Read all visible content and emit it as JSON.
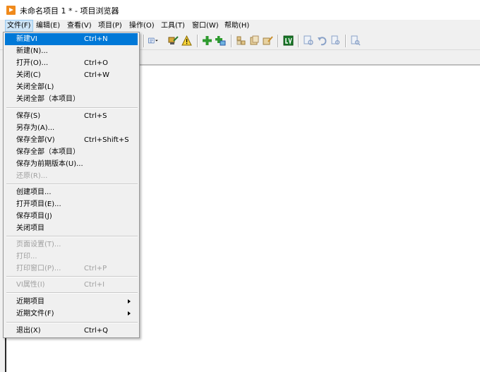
{
  "window": {
    "title": "未命名项目 1 * - 项目浏览器"
  },
  "menubar": [
    {
      "label": "文件(F)"
    },
    {
      "label": "编辑(E)"
    },
    {
      "label": "查看(V)"
    },
    {
      "label": "项目(P)"
    },
    {
      "label": "操作(O)"
    },
    {
      "label": "工具(T)"
    },
    {
      "label": "窗口(W)"
    },
    {
      "label": "帮助(H)"
    }
  ],
  "file_menu": {
    "groups": [
      [
        {
          "label": "新建VI",
          "shortcut": "Ctrl+N",
          "selected": true
        },
        {
          "label": "新建(N)...",
          "shortcut": ""
        },
        {
          "label": "打开(O)...",
          "shortcut": "Ctrl+O"
        },
        {
          "label": "关闭(C)",
          "shortcut": "Ctrl+W"
        },
        {
          "label": "关闭全部(L)",
          "shortcut": ""
        },
        {
          "label": "关闭全部（本项目）",
          "shortcut": ""
        }
      ],
      [
        {
          "label": "保存(S)",
          "shortcut": "Ctrl+S"
        },
        {
          "label": "另存为(A)...",
          "shortcut": ""
        },
        {
          "label": "保存全部(V)",
          "shortcut": "Ctrl+Shift+S"
        },
        {
          "label": "保存全部（本项目）",
          "shortcut": ""
        },
        {
          "label": "保存为前期版本(U)...",
          "shortcut": ""
        },
        {
          "label": "还原(R)...",
          "shortcut": "",
          "disabled": true
        }
      ],
      [
        {
          "label": "创建项目...",
          "shortcut": ""
        },
        {
          "label": "打开项目(E)...",
          "shortcut": ""
        },
        {
          "label": "保存项目(J)",
          "shortcut": ""
        },
        {
          "label": "关闭项目",
          "shortcut": ""
        }
      ],
      [
        {
          "label": "页面设置(T)...",
          "shortcut": "",
          "disabled": true
        },
        {
          "label": "打印...",
          "shortcut": "",
          "disabled": true
        },
        {
          "label": "打印窗口(P)...",
          "shortcut": "Ctrl+P",
          "disabled": true
        }
      ],
      [
        {
          "label": "VI属性(I)",
          "shortcut": "Ctrl+I",
          "disabled": true
        }
      ],
      [
        {
          "label": "近期项目",
          "shortcut": "",
          "submenu": true
        },
        {
          "label": "近期文件(F)",
          "shortcut": "",
          "submenu": true
        }
      ],
      [
        {
          "label": "退出(X)",
          "shortcut": "Ctrl+Q"
        }
      ]
    ]
  },
  "toolbar_icons": [
    "view-dropdown-icon",
    "deploy-icon",
    "warning-icon",
    "add-item-icon",
    "add-folder-icon",
    "build-icon",
    "files-icon",
    "properties-icon",
    "labview-icon",
    "find-icon",
    "undo-icon",
    "search-project-icon",
    "search-icon"
  ],
  "colors": {
    "accent": "#0078d7",
    "app_icon": "#f08a1c",
    "menu_active_bg": "#cce4f7"
  }
}
